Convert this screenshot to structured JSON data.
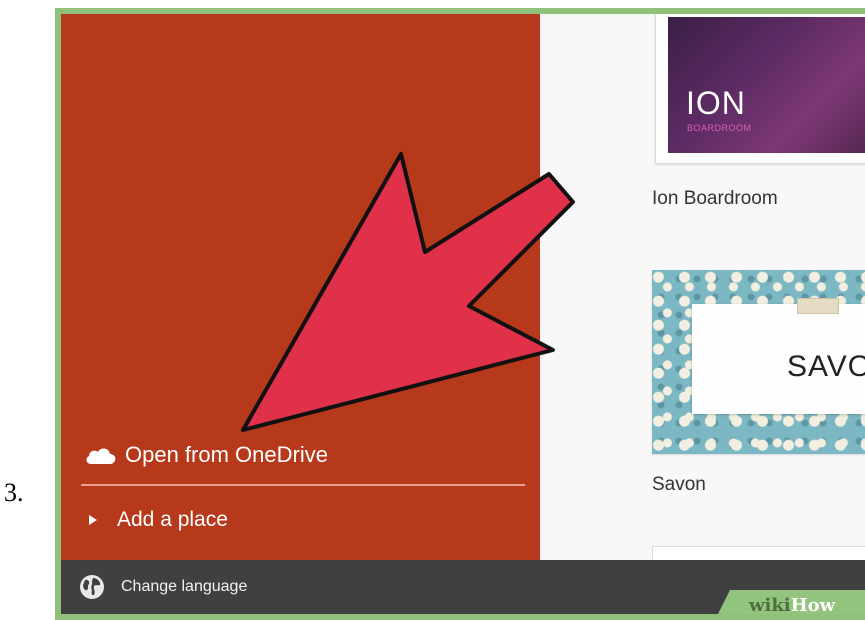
{
  "step_number": "3.",
  "sidebar": {
    "open_onedrive_label": "Open from OneDrive",
    "add_place_label": "Add a place"
  },
  "templates": [
    {
      "name": "Ion Boardroom",
      "thumb_title": "ION",
      "thumb_subtitle": "BOARDROOM"
    },
    {
      "name": "Savon",
      "thumb_title": "SAVON"
    }
  ],
  "footer": {
    "change_language_label": "Change language"
  },
  "watermark": {
    "wiki": "wiki",
    "how": "How"
  },
  "colors": {
    "sidebar_bg": "#b7391b",
    "arrow_fill": "#e0304a",
    "footer_bg": "#404040",
    "frame_green": "#8fc17a"
  },
  "icons": [
    "cloud-icon",
    "play-triangle-icon",
    "globe-icon",
    "pointer-arrow-icon"
  ]
}
